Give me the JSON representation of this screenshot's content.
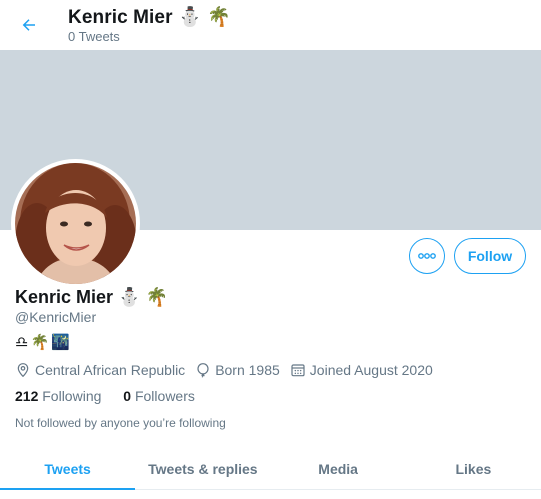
{
  "header": {
    "name": "Kenric Mier ⛄ 🌴",
    "tweet_count": "0 Tweets"
  },
  "profile": {
    "name": "Kenric Mier ⛄ 🌴",
    "handle": "@KenricMier",
    "bio": "♎🌴🌃",
    "location": "Central African Republic",
    "born": "Born 1985",
    "joined": "Joined August 2020",
    "following_count": "212",
    "following_label": "Following",
    "followers_count": "0",
    "followers_label": "Followers",
    "not_followed_text": "Not followed by anyone you’re following"
  },
  "actions": {
    "follow_label": "Follow"
  },
  "tabs": [
    {
      "label": "Tweets"
    },
    {
      "label": "Tweets & replies"
    },
    {
      "label": "Media"
    },
    {
      "label": "Likes"
    }
  ],
  "colors": {
    "accent": "#1da1f2",
    "banner": "#ccd6dd",
    "secondary_text": "#657786"
  },
  "icons": [
    "back-arrow-icon",
    "more-options-icon",
    "location-pin-icon",
    "balloon-icon",
    "calendar-icon"
  ]
}
